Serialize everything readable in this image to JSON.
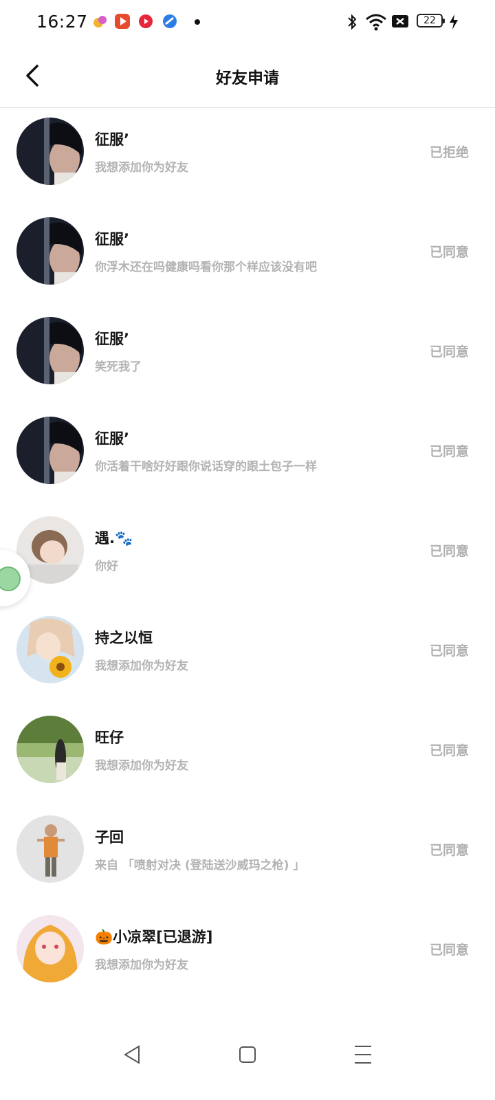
{
  "status_bar": {
    "time": "16:27",
    "battery": "22"
  },
  "header": {
    "title": "好友申请"
  },
  "requests": [
    {
      "name": "征服ʼ",
      "message": "我想添加你为好友",
      "status": "已拒绝",
      "avatar": "dark-hair-portrait"
    },
    {
      "name": "征服ʼ",
      "message": "你浮木还在吗健康吗看你那个样应该没有吧",
      "status": "已同意",
      "avatar": "dark-hair-portrait"
    },
    {
      "name": "征服ʼ",
      "message": "笑死我了",
      "status": "已同意",
      "avatar": "dark-hair-portrait"
    },
    {
      "name": "征服ʼ",
      "message": "你活着干啥好好跟你说话穿的跟土包子一样",
      "status": "已同意",
      "avatar": "dark-hair-portrait"
    },
    {
      "name": "遇.🐾",
      "message": "你好",
      "status": "已同意",
      "avatar": "girl-portrait"
    },
    {
      "name": "持之以恒",
      "message": "我想添加你为好友",
      "status": "已同意",
      "avatar": "anime-sunflower"
    },
    {
      "name": "旺仔",
      "message": "我想添加你为好友",
      "status": "已同意",
      "avatar": "nature-girl"
    },
    {
      "name": "子回",
      "message": "来自 「喷射对决 (登陆送沙威玛之枪) 」",
      "status": "已同意",
      "avatar": "game-character"
    },
    {
      "name": "🎃小凉翠[已退游]",
      "message": "我想添加你为好友",
      "status": "已同意",
      "avatar": "cartoon-girl"
    }
  ],
  "colors": {
    "name_text": "#161616",
    "message_text": "#b3b3b3",
    "status_text": "#b0b0b0",
    "divider": "#e6e6e6"
  }
}
